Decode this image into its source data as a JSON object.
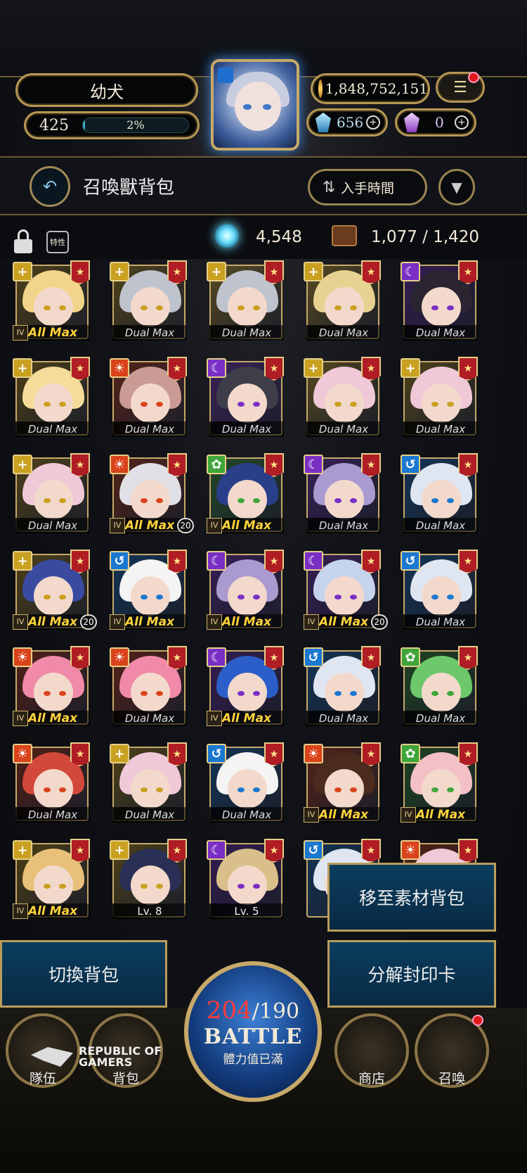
{
  "player": {
    "name": "幼犬",
    "level": "425",
    "exp_percent": "2%",
    "gold": "1,848,752,151",
    "blue_gems": "656",
    "purple_gems": "0"
  },
  "header": {
    "title": "召喚獸背包",
    "sort_label": "入手時間"
  },
  "info": {
    "trait_label": "特性",
    "orbs": "4,548",
    "capacity": "1,077 / 1,420"
  },
  "colors": {
    "fire": "#d9431b",
    "light": "#c9a020",
    "water": "#1a78d0",
    "dark": "#7a2fc4",
    "wood": "#3fa63a",
    "gold": "#c7a969"
  },
  "cards": [
    {
      "elem": "light",
      "label": "All Max",
      "max": true,
      "rank": "IV",
      "hair": "#f2d48a"
    },
    {
      "elem": "light",
      "label": "Dual Max",
      "hair": "#bfc3ce"
    },
    {
      "elem": "light",
      "label": "Dual Max",
      "hair": "#bfc3ce"
    },
    {
      "elem": "light",
      "label": "Dual Max",
      "hair": "#e8d291"
    },
    {
      "elem": "dark",
      "label": "Dual Max",
      "hair": "#2a2530"
    },
    {
      "elem": "light",
      "label": "Dual Max",
      "hair": "#f5dc9a"
    },
    {
      "elem": "fire",
      "label": "Dual Max",
      "hair": "#c99b94"
    },
    {
      "elem": "dark",
      "label": "Dual Max",
      "hair": "#3e3d4a"
    },
    {
      "elem": "light",
      "label": "Dual Max",
      "hair": "#f0c9d8"
    },
    {
      "elem": "light",
      "label": "Dual Max",
      "hair": "#f0c9d8"
    },
    {
      "elem": "light",
      "label": "Dual Max",
      "hair": "#f0c9d8"
    },
    {
      "elem": "fire",
      "label": "All Max",
      "max": true,
      "rank": "IV",
      "twenty": "20",
      "hair": "#e0e0e6"
    },
    {
      "elem": "wood",
      "label": "All Max",
      "max": true,
      "rank": "IV",
      "hair": "#2a3f8a"
    },
    {
      "elem": "dark",
      "label": "Dual Max",
      "hair": "#a99ad0"
    },
    {
      "elem": "water",
      "label": "Dual Max",
      "hair": "#dfe6f2"
    },
    {
      "elem": "light",
      "label": "All Max",
      "max": true,
      "rank": "IV",
      "twenty": "20",
      "hair": "#3a4aa0"
    },
    {
      "elem": "water",
      "label": "All Max",
      "max": true,
      "rank": "IV",
      "hair": "#f4f4f4"
    },
    {
      "elem": "dark",
      "label": "All Max",
      "max": true,
      "rank": "IV",
      "hair": "#a99ad0"
    },
    {
      "elem": "dark",
      "label": "All Max",
      "max": true,
      "rank": "IV",
      "twenty": "20",
      "hair": "#c6d3ec"
    },
    {
      "elem": "water",
      "label": "Dual Max",
      "hair": "#dfe6f2"
    },
    {
      "elem": "fire",
      "label": "All Max",
      "max": true,
      "rank": "IV",
      "hair": "#f08aa8"
    },
    {
      "elem": "fire",
      "label": "Dual Max",
      "hair": "#f08aa8"
    },
    {
      "elem": "dark",
      "label": "All Max",
      "max": true,
      "rank": "IV",
      "hair": "#2b5ec8"
    },
    {
      "elem": "water",
      "label": "Dual Max",
      "hair": "#dfe6f2"
    },
    {
      "elem": "wood",
      "label": "Dual Max",
      "hair": "#6cc86a"
    },
    {
      "elem": "fire",
      "label": "Dual Max",
      "hair": "#d2483a"
    },
    {
      "elem": "light",
      "label": "Dual Max",
      "hair": "#f0c9d8"
    },
    {
      "elem": "water",
      "label": "Dual Max",
      "hair": "#f4f4f4"
    },
    {
      "elem": "fire",
      "label": "All Max",
      "max": true,
      "rank": "IV",
      "hair": "#4a2b1e"
    },
    {
      "elem": "wood",
      "label": "All Max",
      "max": true,
      "rank": "IV",
      "hair": "#f2c0c6"
    },
    {
      "elem": "light",
      "label": "All Max",
      "max": true,
      "rank": "IV",
      "hair": "#e9c07a"
    },
    {
      "elem": "light",
      "label": "Lv. 8",
      "lv": true,
      "hair": "#2a2f55"
    },
    {
      "elem": "dark",
      "label": "Lv. 5",
      "lv": true,
      "hair": "#d9c08a"
    },
    {
      "elem": "water",
      "label": "",
      "hair": "#dfe6f2"
    },
    {
      "elem": "fire",
      "label": "",
      "hair": "#f0c9d8"
    }
  ],
  "buttons": {
    "move": "移至素材背包",
    "switch": "切換背包",
    "decompose": "分解封印卡"
  },
  "battle": {
    "current": "204",
    "max": "/190",
    "label": "BATTLE",
    "sub": "體力值已滿"
  },
  "nav": {
    "team": "隊伍",
    "bag": "背包",
    "shop": "商店",
    "summon": "召喚"
  },
  "watermark": {
    "line1": "REPUBLIC OF",
    "line2": "GAMERS"
  }
}
